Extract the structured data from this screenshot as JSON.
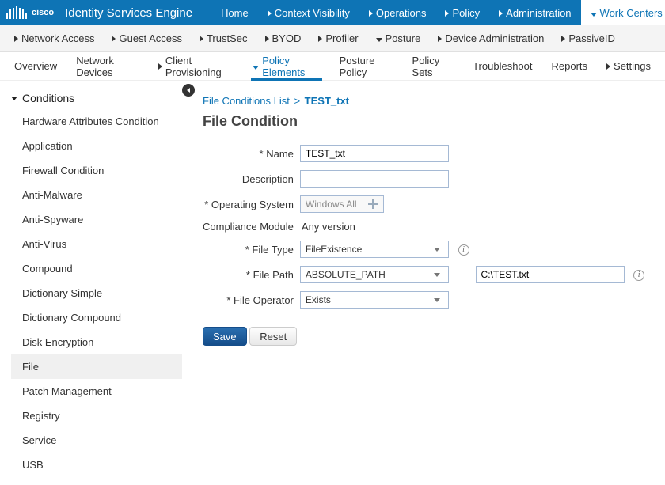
{
  "brand": {
    "name": "cisco",
    "app_title": "Identity Services Engine"
  },
  "topnav": {
    "items": [
      {
        "label": "Home",
        "caret": ""
      },
      {
        "label": "Context Visibility",
        "caret": "r"
      },
      {
        "label": "Operations",
        "caret": "r"
      },
      {
        "label": "Policy",
        "caret": "r"
      },
      {
        "label": "Administration",
        "caret": "r"
      },
      {
        "label": "Work Centers",
        "caret": "d"
      }
    ],
    "active_index": 5
  },
  "subnav": {
    "items": [
      {
        "label": "Network Access",
        "caret": "r"
      },
      {
        "label": "Guest Access",
        "caret": "r"
      },
      {
        "label": "TrustSec",
        "caret": "r"
      },
      {
        "label": "BYOD",
        "caret": "r"
      },
      {
        "label": "Profiler",
        "caret": "r"
      },
      {
        "label": "Posture",
        "caret": "d"
      },
      {
        "label": "Device Administration",
        "caret": "r"
      },
      {
        "label": "PassiveID",
        "caret": "r"
      }
    ],
    "active_index": 5
  },
  "subsubnav": {
    "items": [
      {
        "label": "Overview",
        "caret": ""
      },
      {
        "label": "Network Devices",
        "caret": ""
      },
      {
        "label": "Client Provisioning",
        "caret": "r"
      },
      {
        "label": "Policy Elements",
        "caret": "d"
      },
      {
        "label": "Posture Policy",
        "caret": ""
      },
      {
        "label": "Policy Sets",
        "caret": ""
      },
      {
        "label": "Troubleshoot",
        "caret": ""
      },
      {
        "label": "Reports",
        "caret": ""
      },
      {
        "label": "Settings",
        "caret": "r"
      }
    ],
    "active_index": 3
  },
  "sidebar": {
    "section_title": "Conditions",
    "items": [
      "Hardware Attributes Condition",
      "Application",
      "Firewall Condition",
      "Anti-Malware",
      "Anti-Spyware",
      "Anti-Virus",
      "Compound",
      "Dictionary Simple",
      "Dictionary Compound",
      "Disk Encryption",
      "File",
      "Patch Management",
      "Registry",
      "Service",
      "USB"
    ],
    "active_index": 10
  },
  "breadcrumb": {
    "parent": "File Conditions List",
    "sep": ">",
    "current": "TEST_txt"
  },
  "page_heading": "File Condition",
  "form": {
    "name_label": "* Name",
    "name_value": "TEST_txt",
    "description_label": "Description",
    "description_value": "",
    "os_label": "* Operating System",
    "os_value": "Windows All",
    "compliance_label": "Compliance Module",
    "compliance_value": "Any version",
    "file_type_label": "* File Type",
    "file_type_value": "FileExistence",
    "file_path_label": "* File Path",
    "file_path_value": "ABSOLUTE_PATH",
    "file_path_extra": "C:\\TEST.txt",
    "file_operator_label": "* File Operator",
    "file_operator_value": "Exists"
  },
  "buttons": {
    "save": "Save",
    "reset": "Reset"
  }
}
